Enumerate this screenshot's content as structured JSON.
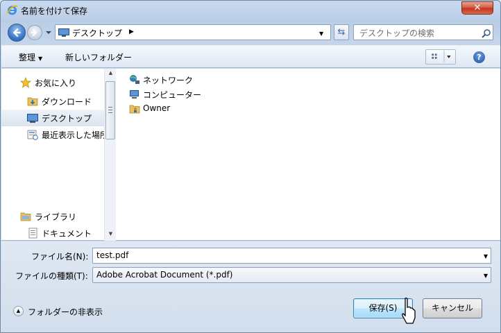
{
  "window": {
    "title": "名前を付けて保存",
    "close_label": "✕"
  },
  "navigation": {
    "address": "デスクトップ",
    "search_placeholder": "デスクトップの検索"
  },
  "toolbar": {
    "organize_label": "整理",
    "new_folder_label": "新しいフォルダー",
    "help_label": "?"
  },
  "sidebar": {
    "items": [
      {
        "label": "お気に入り",
        "icon": "star-icon"
      },
      {
        "label": "ダウンロード",
        "icon": "downloads-folder-icon"
      },
      {
        "label": "デスクトップ",
        "icon": "desktop-icon",
        "selected": true
      },
      {
        "label": "最近表示した場所",
        "icon": "recent-places-icon"
      },
      {
        "label": "ライブラリ",
        "icon": "library-icon"
      },
      {
        "label": "ドキュメント",
        "icon": "documents-icon"
      }
    ]
  },
  "files": [
    {
      "label": "ネットワーク",
      "icon": "network-icon"
    },
    {
      "label": "コンピューター",
      "icon": "computer-icon"
    },
    {
      "label": "Owner",
      "icon": "user-folder-icon"
    }
  ],
  "form": {
    "filename_label": "ファイル名(N):",
    "filename_value": "test.pdf",
    "filetype_label": "ファイルの種類(T):",
    "filetype_value": "Adobe Acrobat Document (*.pdf)"
  },
  "footer": {
    "hide_folders_label": "フォルダーの非表示",
    "save_label": "保存(S)",
    "cancel_label": "キャンセル"
  },
  "colors": {
    "accent": "#3c7fb1",
    "selection": "#d9e3ef"
  }
}
